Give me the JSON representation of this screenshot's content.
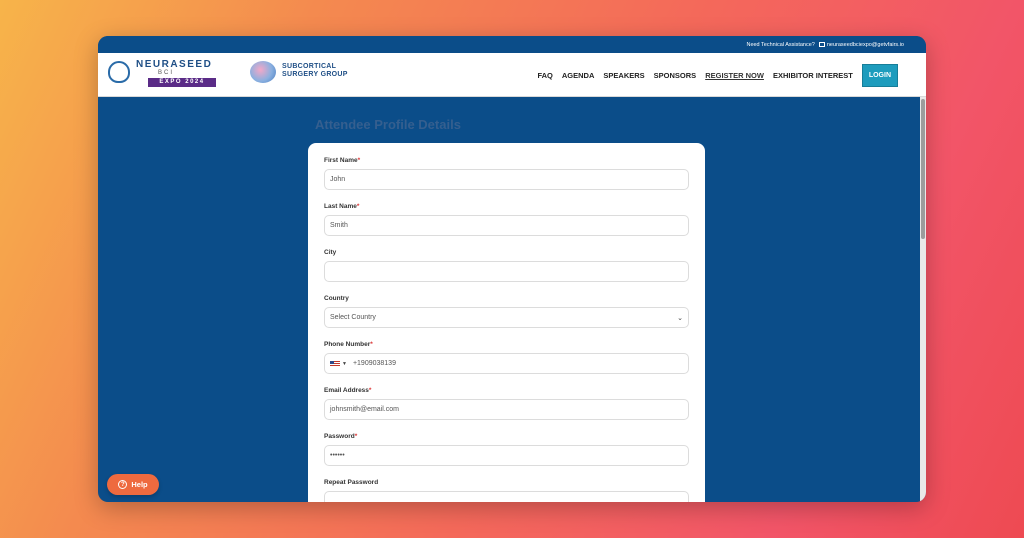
{
  "topbar": {
    "assistance": "Need Technical Assistance?",
    "email": "neuraseedbciexpo@getvfairs.io"
  },
  "logos": {
    "neuraseed_name": "NEURASEED",
    "neuraseed_bci": "BCI",
    "neuraseed_expo": "EXPO 2024",
    "sponsor_line1": "SUBCORTICAL",
    "sponsor_line2": "SURGERY GROUP"
  },
  "nav": {
    "faq": "FAQ",
    "agenda": "AGENDA",
    "speakers": "SPEAKERS",
    "sponsors": "SPONSORS",
    "register": "REGISTER NOW",
    "exhibitor": "EXHIBITOR INTEREST",
    "login": "LOGIN"
  },
  "form": {
    "title": "Attendee Profile Details",
    "first_name": {
      "label": "First Name",
      "value": "John"
    },
    "last_name": {
      "label": "Last Name",
      "value": "Smith"
    },
    "city": {
      "label": "City",
      "value": ""
    },
    "country": {
      "label": "Country",
      "value": "Select Country"
    },
    "phone": {
      "label": "Phone Number",
      "value": "+1909038139"
    },
    "email": {
      "label": "Email Address",
      "value": "johnsmith@email.com"
    },
    "password": {
      "label": "Password",
      "value": "••••••"
    },
    "repeat_password": {
      "label": "Repeat Password"
    }
  },
  "help": {
    "label": "Help",
    "glyph": "?"
  },
  "icons": {
    "select_chevron": "⌄",
    "flag_dropdown": "▼"
  }
}
